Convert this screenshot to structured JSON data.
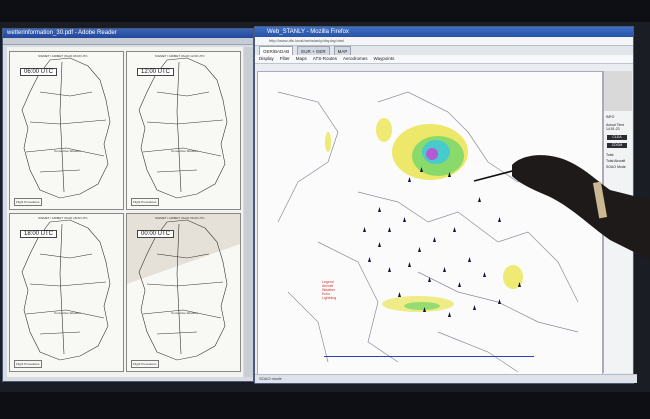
{
  "reader": {
    "title": "wetterinformation_30.pdf - Adobe Reader",
    "pages": [
      {
        "utc": "06:00 UTC",
        "header": "SIGMET / AIRMET VALID 06:00 UTC",
        "footer": "Flight Procedures",
        "note": "Convective Weather"
      },
      {
        "utc": "12:00 UTC",
        "header": "SIGMET / AIRMET VALID 12:00 UTC",
        "footer": "Flight Procedures",
        "note": "Convective Weather"
      },
      {
        "utc": "18:00 UTC",
        "header": "SIGMET / AIRMET VALID 18:00 UTC",
        "footer": "Flight Procedures",
        "note": "Convective Weather"
      },
      {
        "utc": "00:00 UTC",
        "header": "SIGMET / AIRMET VALID 00:00 UTC",
        "footer": "Flight Procedures",
        "note": "Convective Weather"
      }
    ]
  },
  "firefox": {
    "title": "Web_STANLY - Mozilla Firefox",
    "url": "http://www.dfs.local/webstanly/display.html",
    "tabs": [
      "GER/BADAB",
      "EUR + GER",
      "MAP"
    ],
    "menu": [
      "Display",
      "Filter",
      "Maps",
      "ATS-Routes",
      "Aerodromes",
      "Waypoints"
    ],
    "status": "SOAO mode",
    "side": {
      "label_top": "INFO",
      "info_lines": [
        "Actual Time",
        "14:51:23",
        "CLEA"
      ],
      "btn_clear": "CLEA",
      "btn_zoom": "ZOOM",
      "total": "Total",
      "total_aircraft": "Total Aircraft",
      "mode": "SOAO Mode"
    },
    "legend_lines": [
      "Legend",
      "Aircraft",
      "Weather",
      "Echo",
      "Lightning"
    ]
  },
  "colors": {
    "radar_yellow": "#e8e23a",
    "radar_green": "#6fd66b",
    "radar_cyan": "#39c6e6",
    "radar_purple": "#b25bd2",
    "aircraft": "#0e1230",
    "scale": "#2f3fb8"
  }
}
